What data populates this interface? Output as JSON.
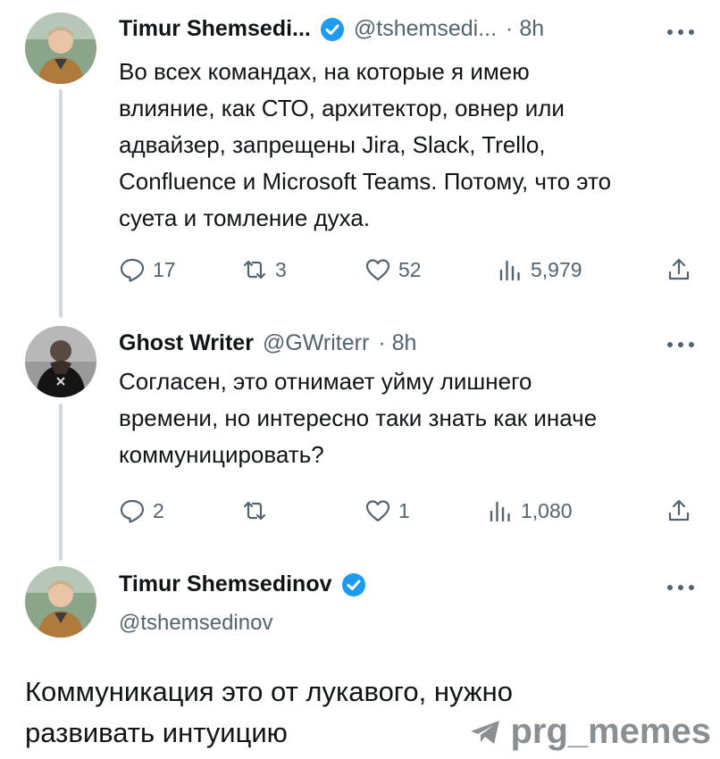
{
  "tweets": [
    {
      "name": "Timur Shemsedi...",
      "handle": "@tshemsedi...",
      "time": "· 8h",
      "text": "Во всех командах, на которые я имею\nвлияние, как СТО, архитектор, овнер или\nадвайзер, запрещены Jira, Slack, Trello,\nConfluence и Microsoft Teams. Потому, что это\nсуета и томление духа.",
      "replies": "17",
      "reposts": "3",
      "likes": "52",
      "views": "5,979"
    },
    {
      "name": "Ghost Writer",
      "handle": "@GWriterr",
      "time": "· 8h",
      "text": "Согласен, это отнимает уйму лишнего\nвремени, но интересно таки знать как иначе\nкоммуницировать?",
      "replies": "2",
      "reposts": "",
      "likes": "1",
      "views": "1,080"
    }
  ],
  "main_tweet": {
    "name": "Timur Shemsedinov",
    "handle": "@tshemsedinov",
    "text": "Коммуникация это от лукавого, нужно\nразвивать интуицию"
  },
  "watermark": "prg_memes",
  "colors": {
    "verified": "#1d9bf0",
    "muted": "#536471",
    "text": "#0f1419",
    "thread_line": "#cfd9de"
  },
  "icons": [
    "verified-badge-icon",
    "more-icon",
    "reply-icon",
    "repost-icon",
    "like-icon",
    "views-icon",
    "share-icon",
    "telegram-icon"
  ]
}
